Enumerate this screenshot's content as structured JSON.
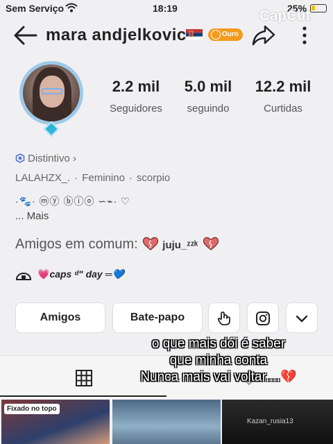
{
  "status_bar": {
    "carrier": "Sem Serviço",
    "time": "18:19",
    "battery": "25%"
  },
  "watermark": "CapCut",
  "profile": {
    "name": "mara andjelkovic",
    "level_badge": "Ouro",
    "stats": [
      {
        "value": "2.2 mil",
        "label": "Seguidores"
      },
      {
        "value": "5.0 mil",
        "label": "seguindo"
      },
      {
        "value": "12.2 mil",
        "label": "Curtidas"
      }
    ],
    "badge_label": "Distintivo",
    "meta": [
      "LALAHZX_.",
      "Feminino",
      "scorpio"
    ],
    "bio_line": "·🐾· ⓜⓨ ⓑⓘⓞ ∽⌁· ♡",
    "more": "... Mais",
    "mutual_label": "Amigos em comum:",
    "mutual_friend": "juju_ᶻᶻᵏ",
    "caps_line": "caps ᵈ\" day ═💙"
  },
  "actions": {
    "friends": "Amigos",
    "chat": "Bate-papo"
  },
  "overlay_caption": {
    "line1": "o que mais dói é saber",
    "line2": "que minha conta",
    "line3": "Nunca mais vai voltar....",
    "heart": "💔"
  },
  "grid": {
    "pinned_label": "Fixado no topo",
    "thumb3_text": "Kazan_rusia13"
  },
  "colors": {
    "badge": "#f49a1e",
    "avatar_frame": "#9ec9e8",
    "heart_pink": "#e83e8c"
  }
}
